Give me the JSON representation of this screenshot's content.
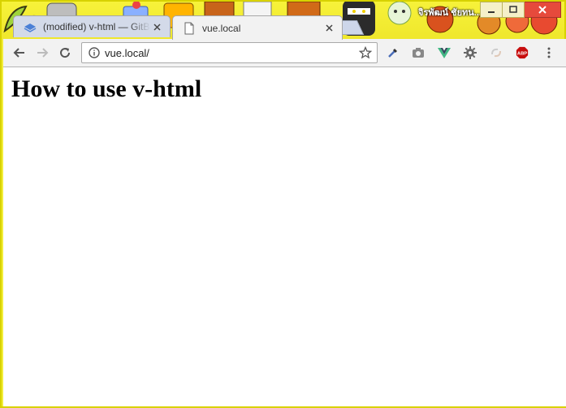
{
  "window": {
    "owner_label": "จิรพัฒน์ ชัยทน..."
  },
  "tabs": [
    {
      "title": "(modified) v-html — GitBook",
      "active": false,
      "icon": "gitbook-icon"
    },
    {
      "title": "vue.local",
      "active": true,
      "icon": "page-icon"
    }
  ],
  "toolbar": {
    "url": "vue.local/",
    "extensions": [
      "eyedropper-icon",
      "camera-icon",
      "vue-devtools-icon",
      "settings-cog-icon",
      "sync-icon",
      "adblock-plus-icon",
      "menu-icon"
    ],
    "adblock_label": "ABP"
  },
  "page": {
    "heading": "How to use v-html"
  },
  "colors": {
    "theme_yellow": "#f2ed3a",
    "tab_inactive": "#d3dae9",
    "toolbar_bg": "#f2f2f2",
    "close_red": "#e64a3c"
  }
}
